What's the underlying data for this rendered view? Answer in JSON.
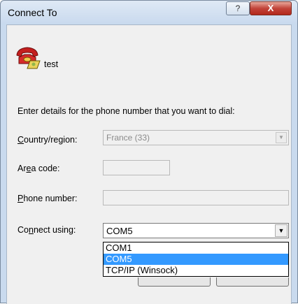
{
  "window": {
    "title": "Connect To",
    "help_glyph": "?",
    "close_glyph": "X"
  },
  "connection": {
    "icon": "red-phone-icon",
    "name": "test"
  },
  "instructions": "Enter details for the phone number that you want to dial:",
  "form": {
    "country_label": {
      "pre": "",
      "u": "C",
      "post": "ountry/region:"
    },
    "country_value": "France (33)",
    "area_label": {
      "pre": "Ar",
      "u": "e",
      "post": "a code:"
    },
    "area_value": "",
    "phone_label": {
      "pre": "",
      "u": "P",
      "post": "hone number:"
    },
    "phone_value": "",
    "connect_label": {
      "pre": "Co",
      "u": "n",
      "post": "nect using:"
    },
    "connect_value": "COM5",
    "connect_options": [
      "COM1",
      "COM5",
      "TCP/IP (Winsock)"
    ],
    "connect_selected_index": 1
  },
  "colors": {
    "selection": "#3399ff",
    "close_button": "#c2443a",
    "frame": "#c9daee"
  }
}
